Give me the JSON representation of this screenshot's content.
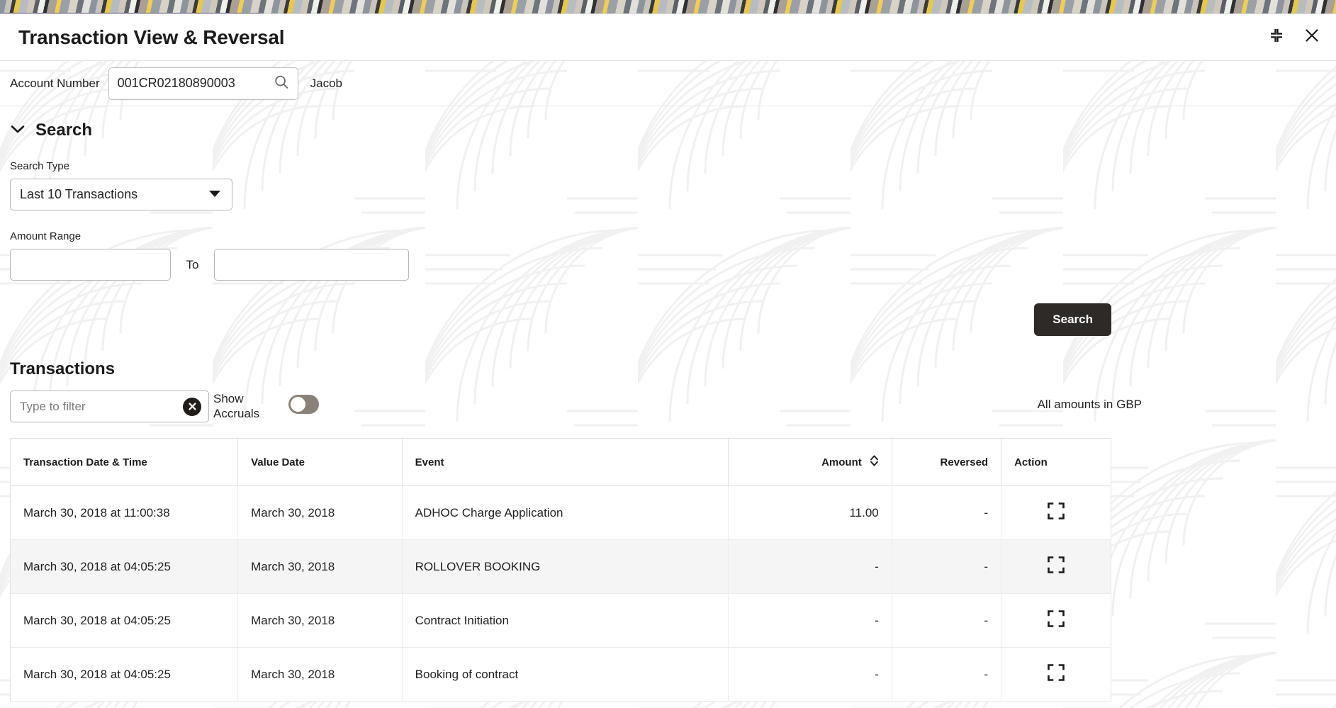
{
  "window": {
    "title": "Transaction View & Reversal",
    "restore_icon": "collapse-icon",
    "close_icon": "close-icon"
  },
  "account": {
    "label": "Account Number",
    "value": "001CR02180890003",
    "placeholder": "",
    "search_icon": "search-icon",
    "owner_name": "Jacob"
  },
  "search_section": {
    "title": "Search",
    "collapse_icon": "chevron-down-icon",
    "search_type_label": "Search Type",
    "search_type_value": "Last 10 Transactions",
    "search_type_options": [
      "Last 10 Transactions"
    ],
    "amount_range_label": "Amount Range",
    "amount_from_value": "",
    "amount_from_placeholder": "",
    "amount_to_separator": "To",
    "amount_to_value": "",
    "amount_to_placeholder": "",
    "search_button_label": "Search"
  },
  "transactions": {
    "title": "Transactions",
    "filter_placeholder": "Type to filter",
    "filter_value": "",
    "clear_icon": "clear-circle-icon",
    "show_accruals_label": "Show Accruals",
    "show_accruals_on": false,
    "currency_note": "All amounts in GBP",
    "columns": [
      {
        "key": "datetime",
        "label": "Transaction Date & Time",
        "align": "left",
        "sortable": false
      },
      {
        "key": "value_date",
        "label": "Value Date",
        "align": "left",
        "sortable": false
      },
      {
        "key": "event",
        "label": "Event",
        "align": "left",
        "sortable": false
      },
      {
        "key": "amount",
        "label": "Amount",
        "align": "right",
        "sortable": true,
        "sort_icon": "sort-icon"
      },
      {
        "key": "reversed",
        "label": "Reversed",
        "align": "right",
        "sortable": false
      },
      {
        "key": "action",
        "label": "Action",
        "align": "center",
        "sortable": false
      }
    ],
    "rows": [
      {
        "datetime": "March 30, 2018 at 11:00:38",
        "value_date": "March 30, 2018",
        "event": "ADHOC Charge Application",
        "amount": "11.00",
        "reversed": "-",
        "action_icon": "expand-icon",
        "highlighted": false
      },
      {
        "datetime": "March 30, 2018 at 04:05:25",
        "value_date": "March 30, 2018",
        "event": "ROLLOVER BOOKING",
        "amount": "-",
        "reversed": "-",
        "action_icon": "expand-icon",
        "highlighted": true
      },
      {
        "datetime": "March 30, 2018 at 04:05:25",
        "value_date": "March 30, 2018",
        "event": "Contract Initiation",
        "amount": "-",
        "reversed": "-",
        "action_icon": "expand-icon",
        "highlighted": false
      },
      {
        "datetime": "March 30, 2018 at 04:05:25",
        "value_date": "March 30, 2018",
        "event": "Booking of contract",
        "amount": "-",
        "reversed": "-",
        "action_icon": "expand-icon",
        "highlighted": false
      }
    ]
  },
  "colors": {
    "button_dark": "#2e2a28",
    "toggle_track": "#8a8179",
    "row_highlight": "#f5f5f5",
    "accent_underline": "#6b6a8a"
  }
}
